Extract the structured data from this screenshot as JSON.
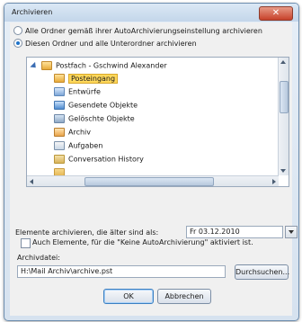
{
  "window": {
    "title": "Archivieren",
    "close_glyph": "✕"
  },
  "options": {
    "radio_all": "Alle Ordner gemäß ihrer AutoArchivierungseinstellung archivieren",
    "radio_this": "Diesen Ordner und alle Unterordner archivieren"
  },
  "tree": {
    "root": "Postfach - Gschwind Alexander",
    "items": [
      {
        "label": "Posteingang",
        "icon": "inbox-folder-icon"
      },
      {
        "label": "Entwürfe",
        "icon": "drafts-folder-icon"
      },
      {
        "label": "Gesendete Objekte",
        "icon": "sent-folder-icon"
      },
      {
        "label": "Gelöschte Objekte",
        "icon": "deleted-folder-icon"
      },
      {
        "label": "Archiv",
        "icon": "archive-folder-icon"
      },
      {
        "label": "Aufgaben",
        "icon": "tasks-folder-icon"
      },
      {
        "label": "Conversation History",
        "icon": "conversation-folder-icon"
      }
    ]
  },
  "older_than": {
    "label": "Elemente archivieren, die älter sind als:",
    "value": "Fr 03.12.2010"
  },
  "include": {
    "label": "Auch Elemente, für die \"Keine AutoArchivierung\" aktiviert ist."
  },
  "archive_file": {
    "label": "Archivdatei:",
    "value": "H:\\Mail Archiv\\archive.pst",
    "browse": "Durchsuchen..."
  },
  "buttons": {
    "ok": "OK",
    "cancel": "Abbrechen"
  }
}
